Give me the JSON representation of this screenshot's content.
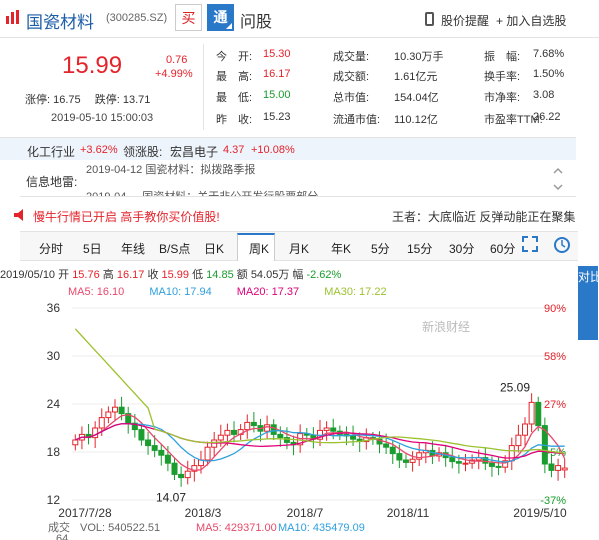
{
  "header": {
    "name": "国瓷材料",
    "code": "(300285.SZ)",
    "buy": "买",
    "tong": "通",
    "ask": "问股",
    "alert": "股价提醒",
    "add": "+ 加入自选股"
  },
  "quote": {
    "price": "15.99",
    "change": "0.76",
    "change_pct": "+4.99%",
    "limit_up_label": "涨停:",
    "limit_up": "16.75",
    "limit_down_label": "跌停:",
    "limit_down": "13.71",
    "time": "2019-05-10 15:00:03",
    "cells": [
      {
        "label": "今　开:",
        "value": "15.30",
        "color": "red"
      },
      {
        "label": "成交量:",
        "value": "10.30万手",
        "color": "plain"
      },
      {
        "label": "振　幅:",
        "value": "7.68%",
        "color": "plain"
      },
      {
        "label": "最　高:",
        "value": "16.17",
        "color": "red"
      },
      {
        "label": "成交额:",
        "value": "1.61亿元",
        "color": "plain"
      },
      {
        "label": "换手率:",
        "value": "1.50%",
        "color": "plain"
      },
      {
        "label": "最　低:",
        "value": "15.00",
        "color": "green"
      },
      {
        "label": "总市值:",
        "value": "154.04亿",
        "color": "plain"
      },
      {
        "label": "市净率:",
        "value": "3.08",
        "color": "plain"
      },
      {
        "label": "昨　收:",
        "value": "15.23",
        "color": "plain"
      },
      {
        "label": "流通市值:",
        "value": "110.12亿",
        "color": "plain"
      },
      {
        "label": "市盈率TTM:",
        "value": "26.22",
        "color": "plain"
      }
    ]
  },
  "industry": {
    "label": "化工行业",
    "pct": "+3.62%",
    "leader_label": "领涨股:",
    "leader": "宏昌电子",
    "leader_price": "4.37",
    "leader_pct": "+10.08%"
  },
  "news": {
    "label": "信息地雷:",
    "item1": "2019-04-12 国瓷材料：拟拨路季报",
    "item2": "2019-04-... 国瓷材料：关于非公开发行股票部分..."
  },
  "promo": {
    "text": "慢牛行情已开启 高手教你买价值股!",
    "right": "王者：大底临近 反弹动能正在聚集"
  },
  "tabs": [
    "分时",
    "5日",
    "年线",
    "B/S点",
    "日K",
    "周K",
    "月K",
    "年K",
    "5分",
    "15分",
    "30分",
    "60分"
  ],
  "bar_info": {
    "date": "2019/05/10",
    "open_l": "开",
    "open": "15.76",
    "high_l": "高",
    "high": "16.17",
    "close_l": "收",
    "close": "15.99",
    "low_l": "低",
    "low": "14.85",
    "amt_l": "额",
    "amt": "54.05万",
    "amp_l": "幅",
    "amp": "-2.62%"
  },
  "ma": {
    "ma5": "MA5: 16.10",
    "ma10": "MA10: 17.94",
    "ma20": "MA20: 17.37",
    "ma30": "MA30: 17.22"
  },
  "side_tab": "对比深指",
  "watermark": "新浪财经",
  "chart_data": {
    "type": "candlestick",
    "ylim": [
      12,
      36
    ],
    "yticks": [
      "36",
      "30",
      "24",
      "18",
      "12"
    ],
    "pct_ticks": [
      "90%",
      "58%",
      "27%",
      "-5%",
      "-37%"
    ],
    "xticks": [
      "2017/7/28",
      "2018/3",
      "2018/7",
      "2018/11",
      "2019/5/10"
    ],
    "annotations": [
      {
        "label": "14.07",
        "value": 14.07
      },
      {
        "label": "25.09",
        "value": 25.09
      }
    ],
    "closes": [
      19.5,
      20.2,
      19.8,
      21.0,
      22.3,
      23.0,
      23.6,
      22.8,
      21.6,
      20.8,
      19.5,
      18.8,
      18.2,
      17.6,
      16.6,
      15.2,
      14.8,
      15.6,
      16.3,
      17.0,
      18.6,
      19.5,
      20.1,
      20.7,
      20.2,
      20.8,
      21.7,
      21.3,
      20.6,
      21.4,
      20.2,
      19.8,
      19.2,
      18.9,
      20.3,
      20.1,
      19.6,
      20.7,
      21.0,
      20.6,
      20.2,
      20.0,
      19.6,
      19.3,
      19.8,
      19.6,
      19.0,
      18.6,
      17.8,
      17.0,
      16.7,
      17.1,
      17.9,
      18.2,
      17.5,
      17.9,
      17.3,
      16.8,
      16.6,
      16.6,
      17.0,
      17.3,
      16.6,
      16.2,
      16.1,
      16.9,
      18.8,
      20.1,
      21.5,
      24.2,
      21.3,
      16.5,
      15.7,
      16.3,
      15.99
    ],
    "ma": [
      {
        "name": "MA5",
        "color": "#e8486b"
      },
      {
        "name": "MA10",
        "color": "#2fa0dd"
      },
      {
        "name": "MA20",
        "color": "#e0007a"
      },
      {
        "name": "MA30",
        "color": "#9cc22f"
      }
    ]
  },
  "volume": {
    "label": "成交",
    "vol": "VOL: 540522.51",
    "ma5": "MA5: 429371.00",
    "ma10": "MA10: 435479.09",
    "axis_label": "64"
  }
}
